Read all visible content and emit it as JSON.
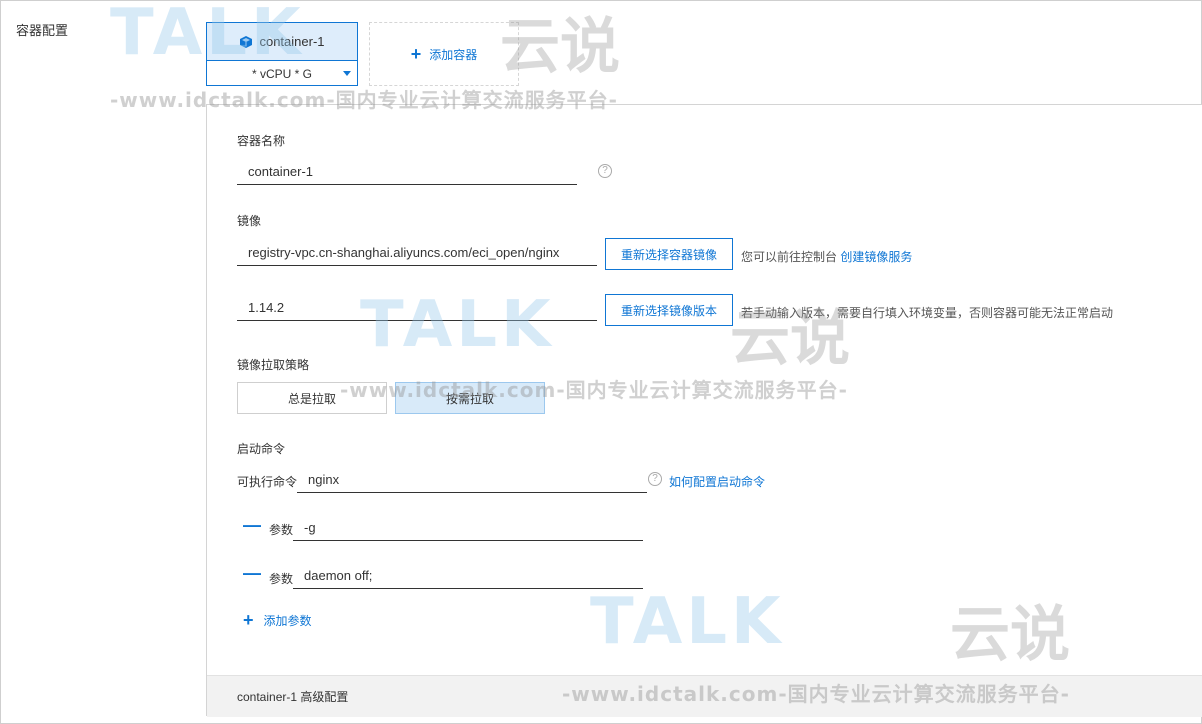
{
  "section_label": "容器配置",
  "container_tab": {
    "name": "container-1",
    "spec": "* vCPU * G"
  },
  "add_container_label": "添加容器",
  "form": {
    "name_label": "容器名称",
    "name_value": "container-1",
    "image_label": "镜像",
    "image_value": "registry-vpc.cn-shanghai.aliyuncs.com/eci_open/nginx",
    "reselect_image_button": "重新选择容器镜像",
    "image_hint_prefix": "您可以前往控制台",
    "image_hint_link": "创建镜像服务",
    "version_value": "1.14.2",
    "reselect_version_button": "重新选择镜像版本",
    "version_hint": "若手动输入版本，需要自行填入环境变量，否则容器可能无法正常启动",
    "pull_policy_label": "镜像拉取策略",
    "pull_policy_options": [
      "总是拉取",
      "按需拉取"
    ],
    "pull_policy_selected": "按需拉取",
    "start_cmd_label": "启动命令",
    "exec_cmd_label": "可执行命令",
    "exec_cmd_value": "nginx",
    "config_cmd_link": "如何配置启动命令",
    "args": [
      {
        "label": "参数",
        "value": "-g"
      },
      {
        "label": "参数",
        "value": "daemon off;"
      }
    ],
    "add_arg_label": "添加参数"
  },
  "advanced_bar": "container-1 高级配置",
  "watermark": {
    "logo": "TALK",
    "cn": "云说",
    "url": "-www.idctalk.com-国内专业云计算交流服务平台-"
  },
  "colors": {
    "accent": "#0f76d4",
    "tab_bg": "#deedfb",
    "selected_seg": "#d8eaf9"
  },
  "icons": [
    "cube-icon",
    "plus-icon",
    "help-icon",
    "minus-icon",
    "caret-down-icon"
  ]
}
